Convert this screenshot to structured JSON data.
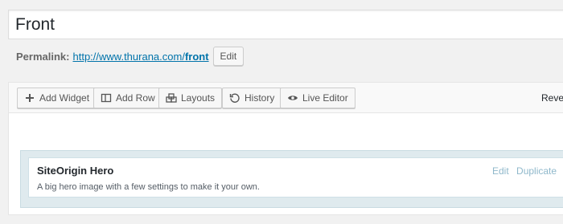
{
  "post": {
    "title": "Front"
  },
  "permalink": {
    "label": "Permalink:",
    "url_base": "http://www.thurana.com/",
    "slug": "front",
    "edit_label": "Edit"
  },
  "toolbar": {
    "buttons": [
      {
        "label": "Add Widget",
        "icon": "plus-icon"
      },
      {
        "label": "Add Row",
        "icon": "row-icon"
      },
      {
        "label": "Layouts",
        "icon": "layouts-icon"
      },
      {
        "label": "History",
        "icon": "history-icon"
      },
      {
        "label": "Live Editor",
        "icon": "eye-icon"
      }
    ],
    "revert_label": "Revert"
  },
  "widget": {
    "title": "SiteOrigin Hero",
    "description": "A big hero image with a few settings to make it your own.",
    "edit_label": "Edit",
    "duplicate_label": "Duplicate"
  },
  "colors": {
    "link": "#0073aa",
    "row_bg": "#dfeaee",
    "widget_action": "#8fb8cb"
  }
}
